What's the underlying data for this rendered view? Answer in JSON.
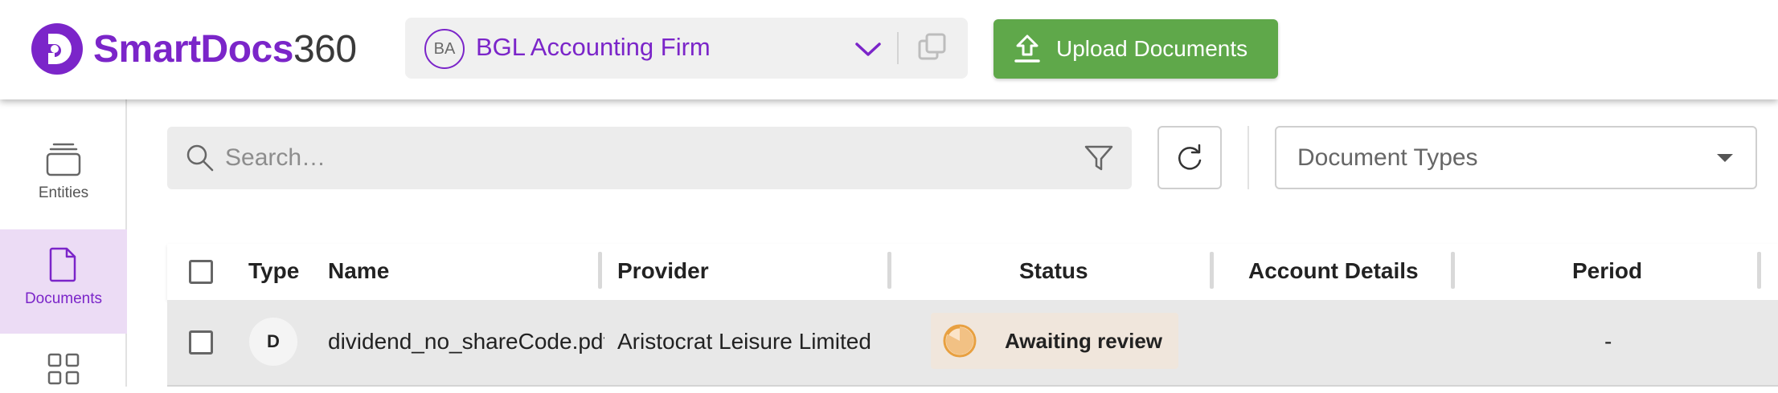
{
  "header": {
    "logo": {
      "brand": "SmartDocs",
      "number": "360",
      "mark_color": "#7b25c9"
    },
    "org_selector": {
      "initials": "BA",
      "name": "BGL Accounting Firm"
    },
    "upload_button": {
      "label": "Upload Documents",
      "color": "#5fa84a"
    }
  },
  "sidebar": {
    "items": [
      {
        "label": "Entities",
        "icon": "stack-icon",
        "active": false
      },
      {
        "label": "Documents",
        "icon": "document-icon",
        "active": true
      },
      {
        "label": "",
        "icon": "grid-icon",
        "active": false
      }
    ]
  },
  "toolbar": {
    "search": {
      "placeholder": "Search…"
    },
    "document_types": {
      "label": "Document Types"
    }
  },
  "table": {
    "columns": [
      "Type",
      "Name",
      "Provider",
      "Status",
      "Account Details",
      "Period"
    ],
    "rows": [
      {
        "type": "D",
        "name": "dividend_no_shareCode.pdf",
        "provider": "Aristocrat Leisure Limited",
        "status": "Awaiting review",
        "account_details": "",
        "period": "-"
      }
    ]
  },
  "colors": {
    "accent": "#7b25c9",
    "success": "#5fa84a",
    "status_pending": "#e8a040"
  }
}
